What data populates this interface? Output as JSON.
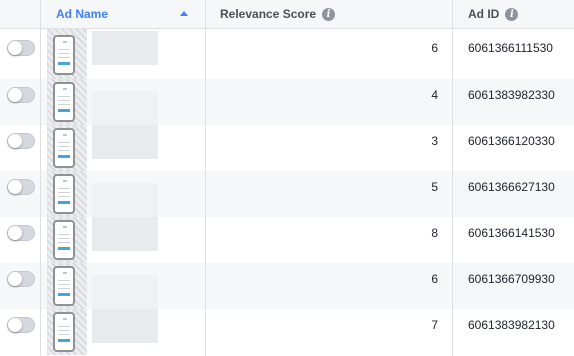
{
  "header": {
    "ad_name": "Ad Name",
    "relevance_score": "Relevance Score",
    "ad_id": "Ad ID",
    "info_icon_glyph": "i"
  },
  "rows": [
    {
      "score": "6",
      "ad_id": "6061366111530",
      "enabled": false
    },
    {
      "score": "4",
      "ad_id": "6061383982330",
      "enabled": false
    },
    {
      "score": "3",
      "ad_id": "6061366120330",
      "enabled": false
    },
    {
      "score": "5",
      "ad_id": "6061366627130",
      "enabled": false
    },
    {
      "score": "8",
      "ad_id": "6061366141530",
      "enabled": false
    },
    {
      "score": "6",
      "ad_id": "6061366709930",
      "enabled": false
    },
    {
      "score": "7",
      "ad_id": "6061383982130",
      "enabled": false
    }
  ],
  "colors": {
    "accent": "#4080ff",
    "header_bg": "#f6f7f9",
    "toggle_off": "#d5d8de"
  }
}
